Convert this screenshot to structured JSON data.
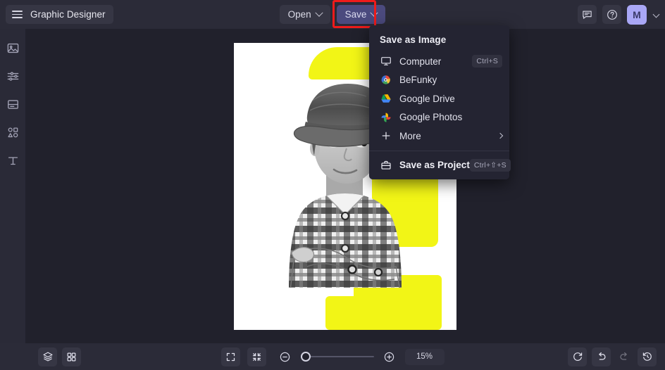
{
  "header": {
    "app_title": "Graphic Designer",
    "menu_icon": "hamburger-icon",
    "open_label": "Open",
    "save_label": "Save",
    "feedback_icon": "chat-bubble-icon",
    "help_icon": "question-circle-icon",
    "avatar_initial": "M",
    "highlight_color": "#ef1b1b",
    "save_button_color": "#4b4a7e",
    "avatar_color": "#a9a7f6"
  },
  "sidebar": {
    "items": [
      {
        "name": "image-tool",
        "icon": "image-icon"
      },
      {
        "name": "edit-tool",
        "icon": "sliders-icon"
      },
      {
        "name": "templates-tool",
        "icon": "layout-icon"
      },
      {
        "name": "graphics-tool",
        "icon": "shapes-icon"
      },
      {
        "name": "text-tool",
        "icon": "text-icon"
      }
    ]
  },
  "save_menu": {
    "heading": "Save as Image",
    "items": [
      {
        "label": "Computer",
        "icon": "monitor-icon",
        "shortcut": "Ctrl+S"
      },
      {
        "label": "BeFunky",
        "icon": "befunky-logo-icon",
        "shortcut": ""
      },
      {
        "label": "Google Drive",
        "icon": "google-drive-icon",
        "shortcut": ""
      },
      {
        "label": "Google Photos",
        "icon": "google-photos-icon",
        "shortcut": ""
      },
      {
        "label": "More",
        "icon": "plus-icon",
        "shortcut": ""
      }
    ],
    "project": {
      "label": "Save as Project",
      "icon": "briefcase-icon",
      "shortcut": "Ctrl+⇧+S"
    }
  },
  "canvas": {
    "artboard_background": "#ffffff",
    "accent_color": "#f2f516",
    "subject_description": "black-and-white photo of a boy in a flat cap and plaid shirt with arms crossed, yellow offset cutout outline"
  },
  "bottom_bar": {
    "layers_icon": "layers-icon",
    "grid_icon": "grid-icon",
    "fullscreen_icon": "expand-icon",
    "fit_icon": "collapse-icon",
    "zoom_out_icon": "minus-circle-icon",
    "zoom_in_icon": "plus-circle-icon",
    "zoom_level": "15%",
    "reset_icon": "refresh-icon",
    "undo_icon": "undo-icon",
    "redo_icon": "redo-icon",
    "history_icon": "history-icon"
  }
}
